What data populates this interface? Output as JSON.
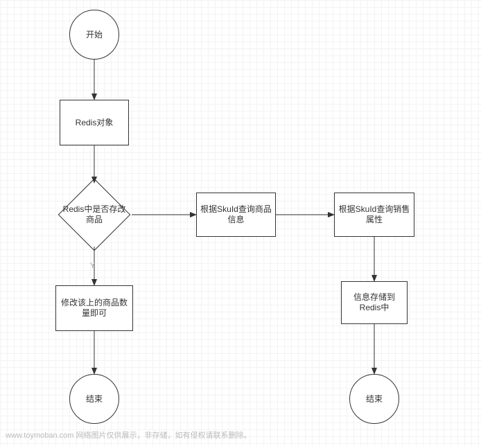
{
  "flowchart": {
    "nodes": {
      "start": {
        "label": "开始",
        "type": "terminator"
      },
      "redis_obj": {
        "label": "Redis对象",
        "type": "process"
      },
      "decision": {
        "label": "Redis中是否存改商品",
        "type": "decision"
      },
      "modify_qty": {
        "label": "修改该上的商品数量即可",
        "type": "process"
      },
      "query_product": {
        "label": "根据SkuId查询商品信息",
        "type": "process"
      },
      "query_attr": {
        "label": "根据SkuId查询销售属性",
        "type": "process"
      },
      "store_redis": {
        "label": "信息存储到Redis中",
        "type": "process"
      },
      "end_left": {
        "label": "结束",
        "type": "terminator"
      },
      "end_right": {
        "label": "结束",
        "type": "terminator"
      }
    },
    "edges": [
      {
        "from": "start",
        "to": "redis_obj"
      },
      {
        "from": "redis_obj",
        "to": "decision"
      },
      {
        "from": "decision",
        "to": "modify_qty",
        "label": "Y"
      },
      {
        "from": "decision",
        "to": "query_product"
      },
      {
        "from": "query_product",
        "to": "query_attr"
      },
      {
        "from": "query_attr",
        "to": "store_redis"
      },
      {
        "from": "modify_qty",
        "to": "end_left"
      },
      {
        "from": "store_redis",
        "to": "end_right"
      }
    ],
    "branch_labels": {
      "yes": "Y"
    }
  },
  "footer": {
    "watermark": "www.toymoban.com 网络图片仅供展示，非存储，如有侵权请联系删除。"
  }
}
